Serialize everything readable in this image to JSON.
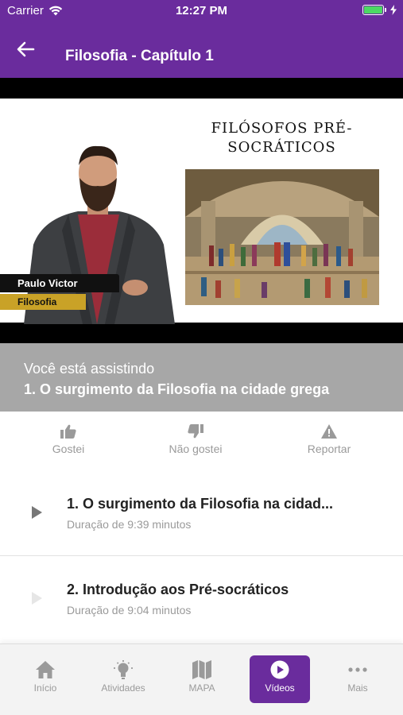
{
  "status_bar": {
    "carrier": "Carrier",
    "time": "12:27 PM"
  },
  "header": {
    "title": "Filosofia - Capítulo 1",
    "back_icon": "arrow-left-icon"
  },
  "video": {
    "slide_title": "FILÓSOFOS PRÉ-SOCRÁTICOS",
    "presenter_name": "Paulo Victor",
    "presenter_subject": "Filosofia"
  },
  "now_playing": {
    "label": "Você está assistindo",
    "title": "1. O surgimento da Filosofia na cidade grega"
  },
  "actions": [
    {
      "label": "Gostei",
      "icon": "thumbs-up-icon"
    },
    {
      "label": "Não gostei",
      "icon": "thumbs-down-icon"
    },
    {
      "label": "Reportar",
      "icon": "warning-icon"
    }
  ],
  "episodes": [
    {
      "title": "1. O surgimento da Filosofia na cidad...",
      "duration": "Duração de 9:39 minutos"
    },
    {
      "title": "2. Introdução aos Pré-socráticos",
      "duration": "Duração de 9:04 minutos"
    }
  ],
  "tabs": [
    {
      "label": "Início",
      "icon": "home-icon"
    },
    {
      "label": "Atividades",
      "icon": "lightbulb-icon"
    },
    {
      "label": "MAPA",
      "icon": "map-icon"
    },
    {
      "label": "Vídeos",
      "icon": "play-circle-icon",
      "active": true
    },
    {
      "label": "Mais",
      "icon": "more-dots-icon"
    }
  ],
  "colors": {
    "brand": "#6a2c9d",
    "now_playing_bg": "#a7a7a7",
    "muted_text": "#9a9a9a"
  }
}
